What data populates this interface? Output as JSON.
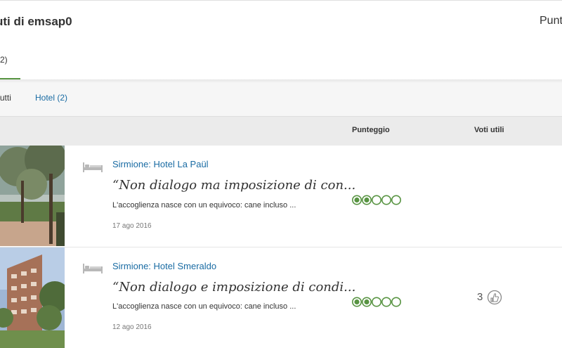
{
  "header": {
    "title": "uti di emsap0",
    "right_label": "Punt"
  },
  "tabs": {
    "active_count": "2)"
  },
  "filters": {
    "all": "Tutti",
    "hotel": "Hotel (2)"
  },
  "columns": {
    "score": "Punteggio",
    "helpful": "Voti utili"
  },
  "reviews": [
    {
      "hotel": "Sirmione: Hotel La Paül",
      "quote": "“Non dialogo ma imposizione di con...",
      "snippet": "L'accoglienza nasce con un equivoco: cane incluso ...",
      "date": "17 ago 2016",
      "rating": 2,
      "rating_max": 5,
      "helpful_votes": ""
    },
    {
      "hotel": "Sirmione: Hotel Smeraldo",
      "quote": "“Non dialogo e imposizione di condi...",
      "snippet": "L'accoglienza nasce con un equivoco: cane incluso ...",
      "date": "12 ago 2016",
      "rating": 2,
      "rating_max": 5,
      "helpful_votes": "3"
    }
  ],
  "colors": {
    "accent": "#589442",
    "link": "#196ba3"
  }
}
